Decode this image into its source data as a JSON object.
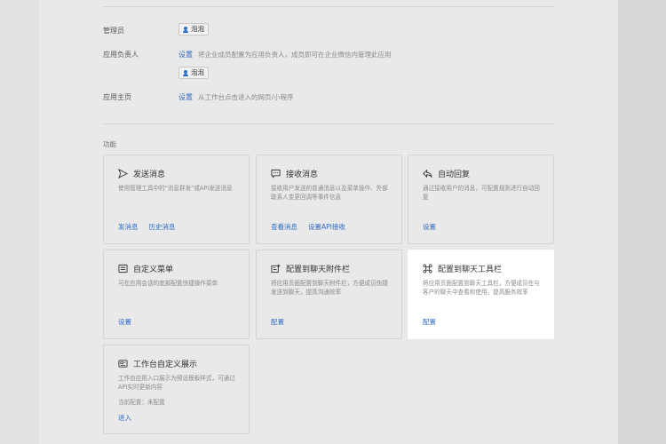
{
  "settings": {
    "admin": {
      "label": "管理员",
      "tag": "泡泡"
    },
    "owner": {
      "label": "应用负责人",
      "link": "设置",
      "hint": "将企业成员配置为应用负责人，成员即可在企业微信内管理此应用",
      "tag": "泡泡"
    },
    "homepage": {
      "label": "应用主页",
      "link": "设置",
      "hint": "从工作台点击进入的网页/小程序"
    }
  },
  "features": {
    "section_title": "功能",
    "cards": [
      {
        "icon": "send-icon",
        "title": "发送消息",
        "desc": "使用管理工具中的\"消息群发\"或API发送消息",
        "actions": [
          "发消息",
          "历史消息"
        ]
      },
      {
        "icon": "chat-bubble-icon",
        "title": "接收消息",
        "desc": "接收用户发送的普通消息以及菜单操作、外部联系人变更回调等事件信息",
        "actions": [
          "查看消息",
          "设置API接收"
        ]
      },
      {
        "icon": "reply-icon",
        "title": "自动回复",
        "desc": "通过接收用户的消息，可配置规则进行自动回复",
        "actions": [
          "设置"
        ]
      },
      {
        "icon": "menu-icon",
        "title": "自定义菜单",
        "desc": "可在应用会话的底部配置快捷操作菜单",
        "actions": [
          "设置"
        ]
      },
      {
        "icon": "attachment-bar-icon",
        "title": "配置到聊天附件栏",
        "desc": "将应用页面配置到聊天附件栏，方便成员快捷发送到聊天，提高沟通效率",
        "actions": [
          "配置"
        ]
      },
      {
        "icon": "command-icon",
        "title": "配置到聊天工具栏",
        "desc": "将应用页面配置到聊天工具栏，方便成员在与客户的聊天中查看和使用，提高服务效率",
        "actions": [
          "配置"
        ]
      },
      {
        "icon": "workbench-icon",
        "title": "工作台自定义展示",
        "desc": "工作台应用入口展示为预设模板样式，可通过API实时更新内容",
        "status": "当前配置：未配置",
        "actions": [
          "进入"
        ]
      }
    ]
  }
}
